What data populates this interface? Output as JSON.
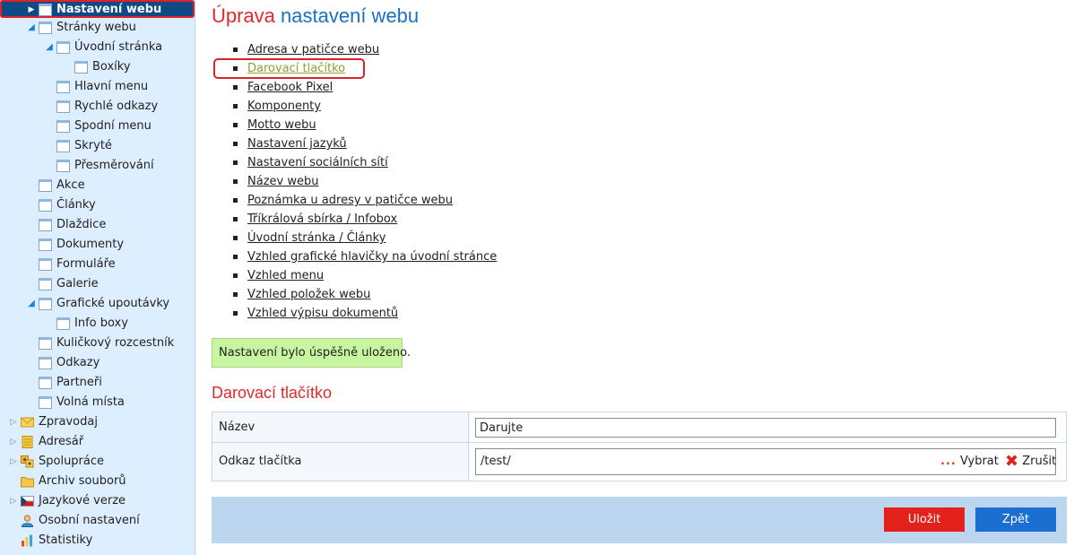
{
  "sidebar": {
    "items": [
      {
        "label": "Nastavení webu",
        "arrow": "▶",
        "icon": "page-icon",
        "selected": true
      },
      {
        "label": "Stránky webu",
        "arrow": "◢",
        "icon": "page-icon"
      },
      {
        "label": "Úvodní stránka",
        "arrow": "◢",
        "icon": "page-icon"
      },
      {
        "label": "Boxíky",
        "arrow": "",
        "icon": "page-icon"
      },
      {
        "label": "Hlavní menu",
        "arrow": "",
        "icon": "page-icon"
      },
      {
        "label": "Rychlé odkazy",
        "arrow": "",
        "icon": "page-icon"
      },
      {
        "label": "Spodní menu",
        "arrow": "",
        "icon": "page-icon"
      },
      {
        "label": "Skryté",
        "arrow": "",
        "icon": "page-icon"
      },
      {
        "label": "Přesměrování",
        "arrow": "",
        "icon": "page-icon"
      },
      {
        "label": "Akce",
        "arrow": "",
        "icon": "page-icon"
      },
      {
        "label": "Články",
        "arrow": "",
        "icon": "page-icon"
      },
      {
        "label": "Dlaždice",
        "arrow": "",
        "icon": "page-icon"
      },
      {
        "label": "Dokumenty",
        "arrow": "",
        "icon": "page-icon"
      },
      {
        "label": "Formuláře",
        "arrow": "",
        "icon": "page-icon"
      },
      {
        "label": "Galerie",
        "arrow": "",
        "icon": "page-icon"
      },
      {
        "label": "Grafické upoutávky",
        "arrow": "◢",
        "icon": "page-icon"
      },
      {
        "label": "Info boxy",
        "arrow": "",
        "icon": "page-icon"
      },
      {
        "label": "Kuličkový rozcestník",
        "arrow": "",
        "icon": "page-icon"
      },
      {
        "label": "Odkazy",
        "arrow": "",
        "icon": "page-icon"
      },
      {
        "label": "Partneři",
        "arrow": "",
        "icon": "page-icon"
      },
      {
        "label": "Volná místa",
        "arrow": "",
        "icon": "page-icon"
      },
      {
        "label": "Zpravodaj",
        "arrow": "▷",
        "icon": "envelope-icon"
      },
      {
        "label": "Adresář",
        "arrow": "▷",
        "icon": "address-book-icon"
      },
      {
        "label": "Spolupráce",
        "arrow": "▷",
        "icon": "collaboration-icon"
      },
      {
        "label": "Archiv souborů",
        "arrow": "",
        "icon": "folder-icon"
      },
      {
        "label": "Jazykové verze",
        "arrow": "▷",
        "icon": "flag-icon"
      },
      {
        "label": "Osobní nastavení",
        "arrow": "",
        "icon": "user-icon"
      },
      {
        "label": "Statistiky",
        "arrow": "",
        "icon": "bar-chart-icon"
      }
    ]
  },
  "header": {
    "title_part1": "Úprava",
    "title_part2": "nastavení webu"
  },
  "links": [
    "Adresa v patičce webu",
    "Darovací tlačítko",
    "Facebook Pixel",
    "Komponenty",
    "Motto webu",
    "Nastavení jazyků",
    "Nastavení sociálních sítí",
    "Název webu",
    "Poznámka u adresy v patičce webu",
    "Tříkrálová sbírka / Infobox",
    "Úvodní stránka / Články",
    "Vzhled grafické hlavičky na úvodní stránce",
    "Vzhled menu",
    "Vzhled položek webu",
    "Vzhled výpisu dokumentů"
  ],
  "active_link_index": 1,
  "success_message": "Nastavení bylo úspěšně uloženo.",
  "section_title": "Darovací tlačítko",
  "form": {
    "name_label": "Název",
    "name_value": "Darujte",
    "link_label": "Odkaz tlačítka",
    "link_value": "/test/",
    "pick_label": "Vybrat",
    "clear_label": "Zrušit"
  },
  "actions": {
    "save_label": "Uložit",
    "back_label": "Zpět"
  },
  "colors": {
    "accent_red": "#e2292b",
    "accent_blue": "#1b6fc4",
    "selected_bg": "#0f4a85",
    "success_bg": "#c8f5a0",
    "save_button": "#e3201a",
    "back_button": "#1b6fd0",
    "active_link": "#8aa033"
  }
}
